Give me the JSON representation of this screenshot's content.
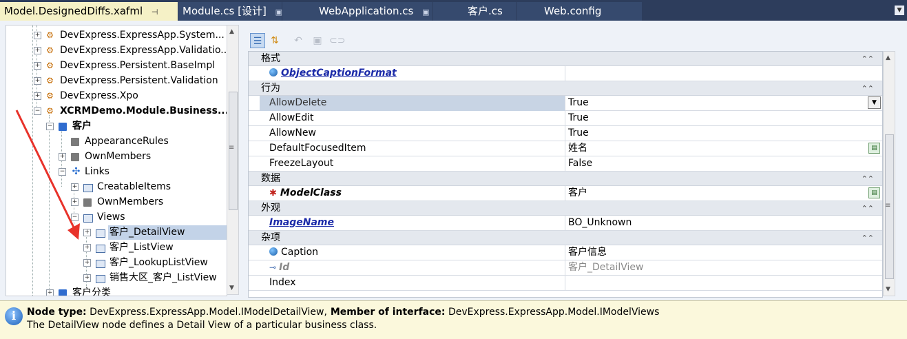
{
  "tabs": [
    {
      "label": "Model.DesignedDiffs.xafml",
      "pin": "⊣"
    },
    {
      "label": "Module.cs [设计]",
      "pin": "▣"
    },
    {
      "label": "WebApplication.cs",
      "pin": "▣"
    },
    {
      "label": "客户.cs",
      "pin": ""
    },
    {
      "label": "Web.config",
      "pin": ""
    }
  ],
  "tree": {
    "items": [
      {
        "label": "DevExpress.ExpressApp.System..."
      },
      {
        "label": "DevExpress.ExpressApp.Validatio..."
      },
      {
        "label": "DevExpress.Persistent.BaseImpl"
      },
      {
        "label": "DevExpress.Persistent.Validation"
      },
      {
        "label": "DevExpress.Xpo"
      },
      {
        "label": "XCRMDemo.Module.Business..."
      },
      {
        "label": "客户"
      },
      {
        "label": "AppearanceRules"
      },
      {
        "label": "OwnMembers"
      },
      {
        "label": "Links"
      },
      {
        "label": "CreatableItems"
      },
      {
        "label": "OwnMembers"
      },
      {
        "label": "Views"
      },
      {
        "label": "客户_DetailView"
      },
      {
        "label": "客户_ListView"
      },
      {
        "label": "客户_LookupListView"
      },
      {
        "label": "销售大区_客户_ListView"
      },
      {
        "label": "客户分类"
      }
    ]
  },
  "properties": {
    "categories": [
      {
        "label": "格式",
        "rows": [
          {
            "name": "ObjectCaptionFormat",
            "value": ""
          }
        ]
      },
      {
        "label": "行为",
        "rows": [
          {
            "name": "AllowDelete",
            "value": "True"
          },
          {
            "name": "AllowEdit",
            "value": "True"
          },
          {
            "name": "AllowNew",
            "value": "True"
          },
          {
            "name": "DefaultFocusedItem",
            "value": "姓名"
          },
          {
            "name": "FreezeLayout",
            "value": "False"
          }
        ]
      },
      {
        "label": "数据",
        "rows": [
          {
            "name": "ModelClass",
            "value": "客户"
          }
        ]
      },
      {
        "label": "外观",
        "rows": [
          {
            "name": "ImageName",
            "value": "BO_Unknown"
          }
        ]
      },
      {
        "label": "杂项",
        "rows": [
          {
            "name": "Caption",
            "value": "客户信息"
          },
          {
            "name": "Id",
            "value": "客户_DetailView"
          },
          {
            "name": "Index",
            "value": ""
          }
        ]
      }
    ]
  },
  "info": {
    "node_type_label": "Node type:",
    "node_type_value": " DevExpress.ExpressApp.Model.IModelDetailView,",
    "member_label": " Member of interface:",
    "member_value": " DevExpress.ExpressApp.Model.IModelViews",
    "description": "The DetailView node defines a Detail View of a particular business class."
  },
  "colors": {
    "tab_bar": "#2d3d5c",
    "active_tab": "#f5f1c6",
    "selection": "#c3d3e8",
    "info_bar": "#fbf8dc",
    "annotation_arrow": "#e8322a"
  }
}
